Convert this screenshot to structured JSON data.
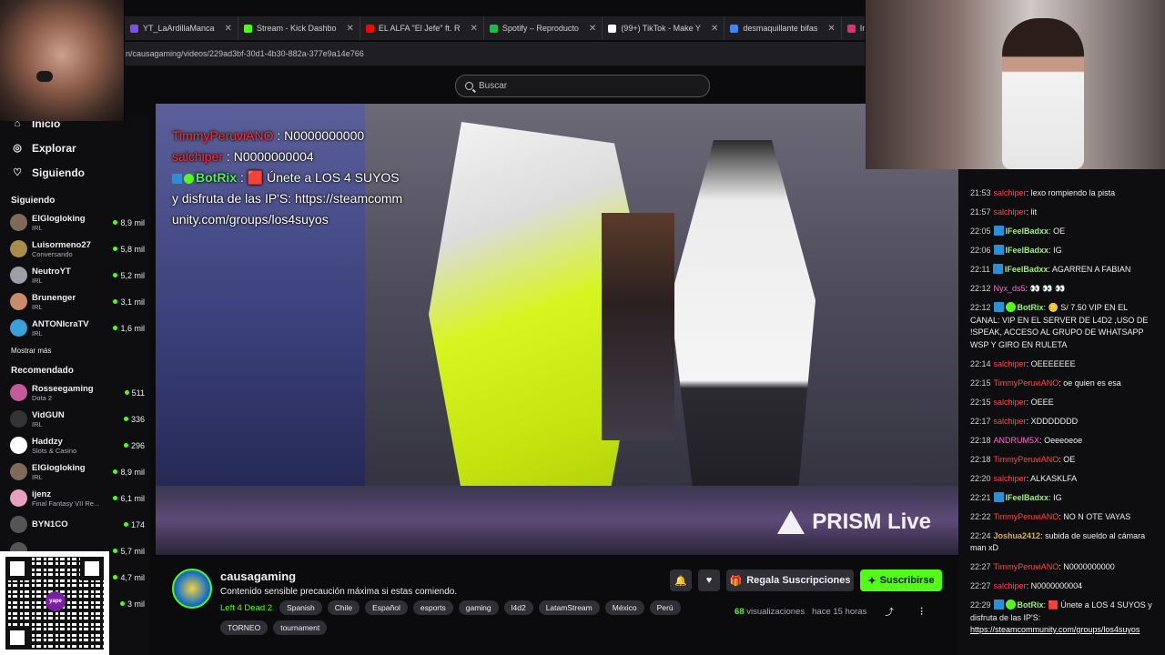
{
  "browser": {
    "tabs": [
      {
        "label": "YT_LaArdillaManca",
        "color": "#7b4dff"
      },
      {
        "label": "Stream - Kick Dashbo",
        "color": "#53fc18"
      },
      {
        "label": "EL ALFA \"El Jefe\" ft. R",
        "color": "#ff0000"
      },
      {
        "label": "Spotify – Reproducto",
        "color": "#1db954"
      },
      {
        "label": "(99+) TikTok - Make Y",
        "color": "#ffffff"
      },
      {
        "label": "desmaquillante bifas",
        "color": "#4285f4"
      },
      {
        "label": "Instagram",
        "color": "#e1306c"
      }
    ],
    "url": "n/causagaming/videos/229ad3bf-30d1-4b30-882a-377e9a14e766"
  },
  "search": {
    "placeholder": "Buscar"
  },
  "sidebar": {
    "nav": [
      {
        "label": "Inicio",
        "icon": "home-icon"
      },
      {
        "label": "Explorar",
        "icon": "compass-icon"
      },
      {
        "label": "Siguiendo",
        "icon": "heart-icon"
      }
    ],
    "following_header": "Siguiendo",
    "following": [
      {
        "name": "ElGlogloking",
        "sub": "IRL",
        "viewers": "8,9 mil",
        "color": "#7f6a5a"
      },
      {
        "name": "Luisormeno27",
        "sub": "Conversando",
        "viewers": "5,8 mil",
        "color": "#a88c4a"
      },
      {
        "name": "NeutroYT",
        "sub": "IRL",
        "viewers": "5,2 mil",
        "color": "#9aa0a6"
      },
      {
        "name": "Brunenger",
        "sub": "IRL",
        "viewers": "3,1 mil",
        "color": "#c98b6b"
      },
      {
        "name": "ANTONIcraTV",
        "sub": "IRL",
        "viewers": "1,6 mil",
        "color": "#3aa0d8"
      }
    ],
    "show_more": "Mostrar más",
    "recommended_header": "Recomendado",
    "recommended": [
      {
        "name": "Rosseegaming",
        "sub": "Dota 2",
        "viewers": "511",
        "color": "#c45a9a"
      },
      {
        "name": "VidGUN",
        "sub": "IRL",
        "viewers": "336",
        "color": "#333333"
      },
      {
        "name": "Haddzy",
        "sub": "Slots & Casino",
        "viewers": "296",
        "color": "#ffffff"
      },
      {
        "name": "ElGlogloking",
        "sub": "IRL",
        "viewers": "8,9 mil",
        "color": "#7f6a5a"
      },
      {
        "name": "ijenz",
        "sub": "Final Fantasy VII Re...",
        "viewers": "6,1 mil",
        "color": "#e8a0c0"
      },
      {
        "name": "BYN1CO",
        "sub": "",
        "viewers": "174",
        "color": "#555555"
      },
      {
        "name": "",
        "sub": "",
        "viewers": "5,7 mil",
        "color": "#555555"
      },
      {
        "name": "",
        "sub": "",
        "viewers": "4,7 mil",
        "color": "#555555"
      },
      {
        "name": "",
        "sub": "",
        "viewers": "3 mil",
        "color": "#555555"
      }
    ]
  },
  "qr": {
    "logo_text": "yape"
  },
  "video": {
    "overlay": [
      {
        "user": "TimmyPeruviANO",
        "text": "N0000000000",
        "user_color": "red"
      },
      {
        "user": "salchiper",
        "text": "N0000000004",
        "user_color": "red"
      },
      {
        "user": "BotRix",
        "text": "🟥 Únete a LOS 4 SUYOS y disfruta de las IP'S: https://steamcommunity.com/groups/los4suyos",
        "user_color": "green"
      }
    ],
    "watermark": "PRISM Live"
  },
  "channel": {
    "name": "causagaming",
    "title": "Contenido sensible precaución máxima si estas comiendo.",
    "category": "Left 4 Dead 2",
    "tags": [
      "Spanish",
      "Chile",
      "Español",
      "esports",
      "gaming",
      "l4d2",
      "LatamStream",
      "México",
      "Perú",
      "TORNEO",
      "tournament"
    ],
    "gift_label": "Regala Suscripciones",
    "subscribe_label": "Suscribirse",
    "views_count": "68",
    "views_label": "visualizaciones",
    "time_ago": "hace 15 horas"
  },
  "chat": {
    "messages": [
      {
        "time": "21:53",
        "user": "salchiper",
        "color": "red",
        "badge": "",
        "text": "lexo rompiendo la pista"
      },
      {
        "time": "21:57",
        "user": "salchiper",
        "color": "red",
        "badge": "",
        "text": "lit"
      },
      {
        "time": "22:05",
        "user": "IFeelBadxx",
        "color": "grn",
        "badge": "mod",
        "text": "OE"
      },
      {
        "time": "22:06",
        "user": "IFeelBadxx",
        "color": "grn",
        "badge": "mod",
        "text": "IG"
      },
      {
        "time": "22:11",
        "user": "IFeelBadxx",
        "color": "grn",
        "badge": "mod",
        "text": "AGARREN A FABIAN"
      },
      {
        "time": "22:12",
        "user": "Nyx_ds5",
        "color": "pur",
        "badge": "",
        "text": "👀 👀 👀"
      },
      {
        "time": "22:12",
        "user": "BotRix",
        "color": "grn",
        "badge": "bot",
        "text": "🪙 S/ 7.50 VIP EN EL CANAL: VIP EN EL SERVER DE L4D2 ,USO DE !SPEAK, ACCESO AL GRUPO DE WHATSAPP WSP Y GIRO EN RULETA"
      },
      {
        "time": "22:14",
        "user": "salchiper",
        "color": "red",
        "badge": "",
        "text": "OEEEEEEE"
      },
      {
        "time": "22:15",
        "user": "TimmyPeruviANO",
        "color": "red",
        "badge": "",
        "text": "oe quien es esa"
      },
      {
        "time": "22:15",
        "user": "salchiper",
        "color": "red",
        "badge": "",
        "text": "OEEE"
      },
      {
        "time": "22:17",
        "user": "salchiper",
        "color": "red",
        "badge": "",
        "text": "XDDDDDDD"
      },
      {
        "time": "22:18",
        "user": "ANDRUM5X",
        "color": "pur",
        "badge": "",
        "text": "Oeeeoeoe"
      },
      {
        "time": "22:18",
        "user": "TimmyPeruviANO",
        "color": "red",
        "badge": "",
        "text": "OE"
      },
      {
        "time": "22:20",
        "user": "salchiper",
        "color": "red",
        "badge": "",
        "text": "ALKASKLFA"
      },
      {
        "time": "22:21",
        "user": "IFeelBadxx",
        "color": "grn",
        "badge": "mod",
        "text": "IG"
      },
      {
        "time": "22:22",
        "user": "TimmyPeruviANO",
        "color": "red",
        "badge": "",
        "text": "NO N OTE VAYAS"
      },
      {
        "time": "22:24",
        "user": "Joshua2412",
        "color": "yel",
        "badge": "",
        "text": "subida de sueldo al cámara man xD"
      },
      {
        "time": "22:27",
        "user": "TimmyPeruviANO",
        "color": "red",
        "badge": "",
        "text": "N0000000000"
      },
      {
        "time": "22:27",
        "user": "salchiper",
        "color": "red",
        "badge": "",
        "text": "N0000000004"
      },
      {
        "time": "22:29",
        "user": "BotRix",
        "color": "grn",
        "badge": "bot",
        "text": "🟥 Únete a LOS 4 SUYOS y disfruta de las IP'S:",
        "link": "https://steamcommunity.com/groups/los4suyos"
      }
    ]
  }
}
